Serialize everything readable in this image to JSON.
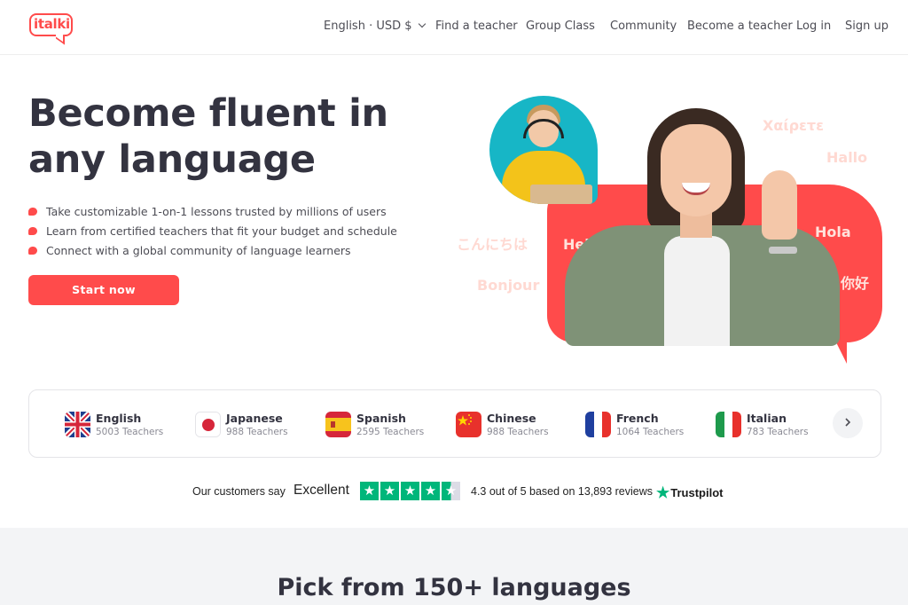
{
  "nav": {
    "logo_text": "italki",
    "locale": "English · USD $",
    "links": [
      "Find a teacher",
      "Group Class",
      "Community",
      "Become a teacher",
      "Log in",
      "Sign up"
    ]
  },
  "hero": {
    "title": "Become fluent in any language",
    "bullets": [
      "Take customizable 1-on-1 lessons trusted by millions of users",
      "Learn from certified teachers that fit your budget and schedule",
      "Connect with a global community of language learners"
    ],
    "cta": "Start now",
    "greetings": [
      "Χαίρετε",
      "Hallo",
      "こんにちは",
      "Hello",
      "Hola",
      "Bonjour",
      "你好"
    ]
  },
  "languages": [
    {
      "name": "English",
      "count": "5003 Teachers",
      "flag": "uk-flag-icon"
    },
    {
      "name": "Japanese",
      "count": "988 Teachers",
      "flag": "japan-flag-icon"
    },
    {
      "name": "Spanish",
      "count": "2595 Teachers",
      "flag": "spain-flag-icon"
    },
    {
      "name": "Chinese",
      "count": "988 Teachers",
      "flag": "china-flag-icon"
    },
    {
      "name": "French",
      "count": "1064 Teachers",
      "flag": "france-flag-icon"
    },
    {
      "name": "Italian",
      "count": "783 Teachers",
      "flag": "italy-flag-icon"
    }
  ],
  "next_icon": "chevron-right-icon",
  "trustpilot": {
    "say": "Our customers say",
    "rating_word": "Excellent",
    "stars": 4.5,
    "score_text": "4.3 out of 5 based on 13,893 reviews",
    "brand": "Trustpilot"
  },
  "section": {
    "heading": "Pick from 150+ languages"
  },
  "colors": {
    "brand": "#ff4b4b",
    "text": "#333340",
    "trustpilot": "#00b67a"
  }
}
